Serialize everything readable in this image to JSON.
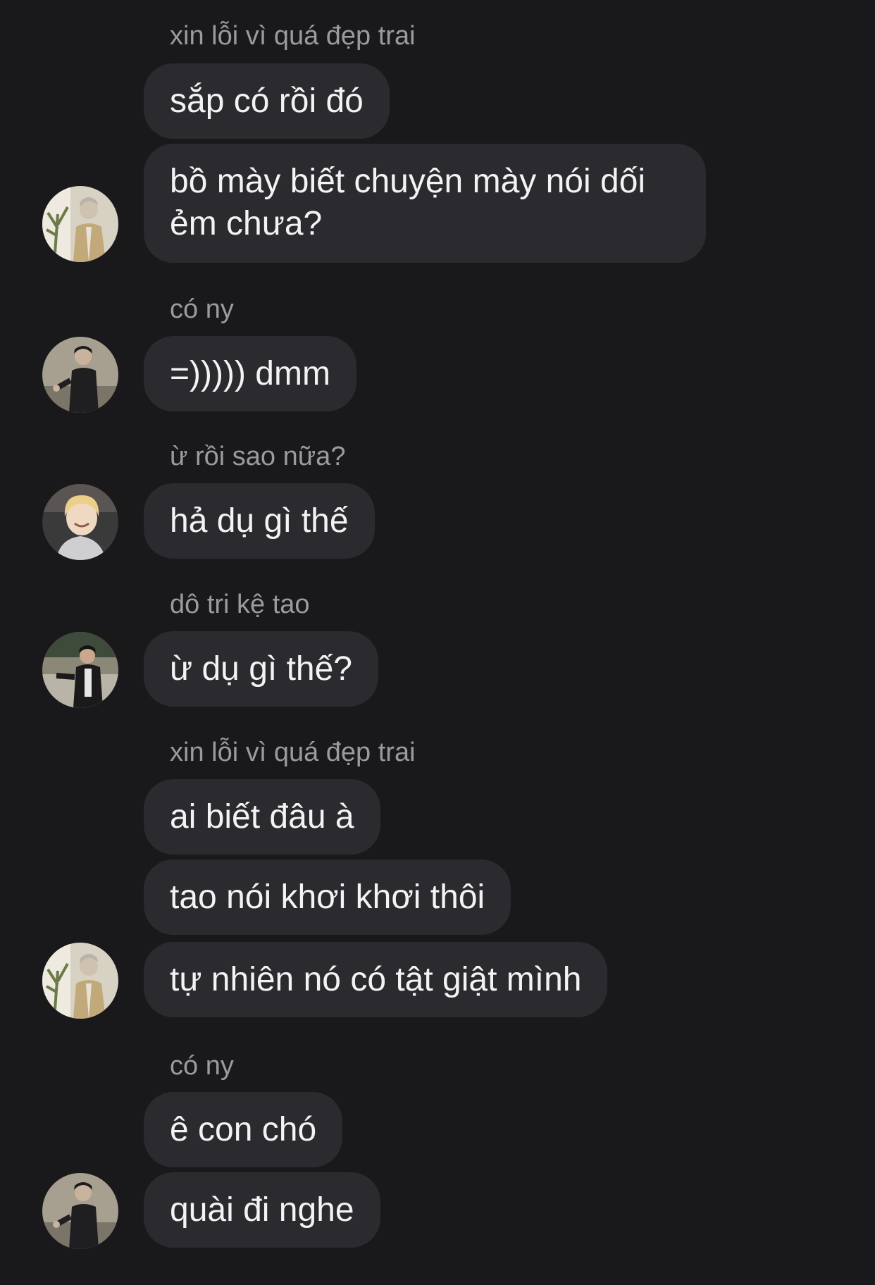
{
  "colors": {
    "background": "#19191b",
    "bubble": "#2b2b2f",
    "text": "#f3f3f5",
    "sender_name": "#9a9aa0"
  },
  "messages": [
    {
      "sender": "xin lỗi vì quá đẹp trai",
      "bubbles": [
        "sắp có rồi đó",
        "bồ mày biết chuyện mày nói dối ẻm chưa?"
      ],
      "avatar": "avatar-man-with-plant-icon"
    },
    {
      "sender": "có ny",
      "bubbles": [
        "=))))) dmm"
      ],
      "avatar": "avatar-man-dark-suit-icon"
    },
    {
      "sender": "ừ rồi sao nữa?",
      "bubbles": [
        "hả dụ gì thế"
      ],
      "avatar": "avatar-blonde-smiling-icon"
    },
    {
      "sender": "dô tri kệ tao",
      "bubbles": [
        "ừ dụ gì thế?"
      ],
      "avatar": "avatar-man-dark-jacket-icon"
    },
    {
      "sender": "xin lỗi vì quá đẹp trai",
      "bubbles": [
        "ai biết đâu à",
        "tao nói khơi khơi thôi",
        "tự nhiên nó có tật giật mình"
      ],
      "avatar": "avatar-man-with-plant-icon"
    },
    {
      "sender": "có ny",
      "bubbles": [
        "ê con chó",
        "quài đi nghe"
      ],
      "avatar": "avatar-man-dark-suit-icon"
    }
  ]
}
